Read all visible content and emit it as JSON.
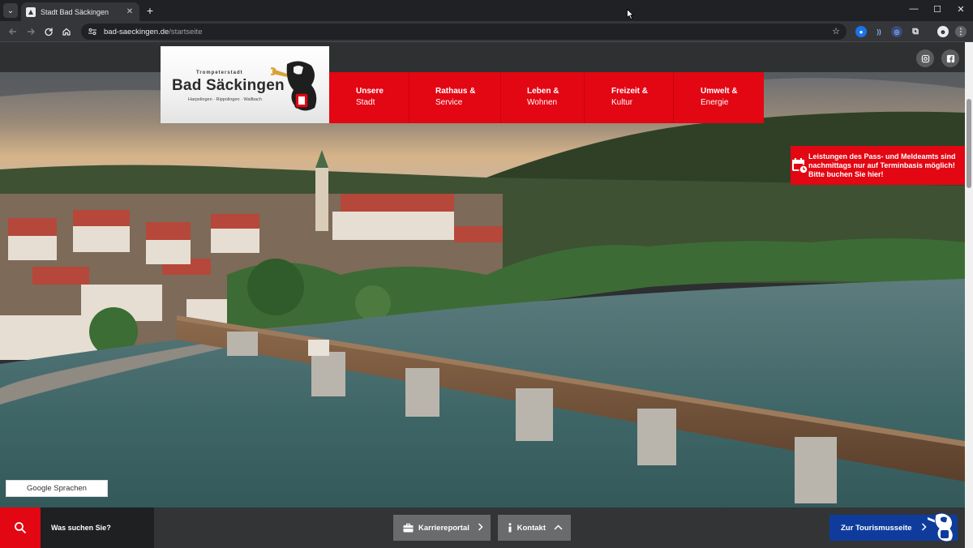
{
  "browser": {
    "tab_title": "Stadt Bad Säckingen",
    "tab_close": "✕",
    "new_tab": "+",
    "url_host": "bad-saeckingen.de",
    "url_path": "/startseite",
    "window_controls": [
      "—",
      "☐",
      "✕"
    ],
    "icons": [
      "tab-search-icon",
      "back-icon",
      "forward-icon",
      "reload-icon",
      "home-icon",
      "site-info-icon",
      "bookmark-star-icon",
      "kebab-menu-icon"
    ]
  },
  "logo": {
    "tagline": "Trompeterstadt",
    "name": "Bad Säckingen",
    "districts": "Harpolingen · Rippolingen · Wallbach"
  },
  "nav": {
    "items": [
      {
        "line1": "Unsere",
        "line2": "Stadt"
      },
      {
        "line1": "Rathaus &",
        "line2": "Service"
      },
      {
        "line1": "Leben &",
        "line2": "Wohnen"
      },
      {
        "line1": "Freizeit &",
        "line2": "Kultur"
      },
      {
        "line1": "Umwelt &",
        "line2": "Energie"
      }
    ]
  },
  "notice": {
    "text": "Leistungen des Pass- und Meldeamts sind nachmittags nur auf Terminbasis möglich! Bitte buchen Sie hier!"
  },
  "language": {
    "label": "Google Sprachen"
  },
  "bottom": {
    "search_placeholder": "Was suchen Sie?",
    "career": "Karriereportal",
    "contact": "Kontakt",
    "tourism": "Zur Tourismusseite"
  },
  "colors": {
    "brand_red": "#e30613",
    "tourism_blue": "#0f3c9c",
    "chrome_dark": "#202124"
  }
}
